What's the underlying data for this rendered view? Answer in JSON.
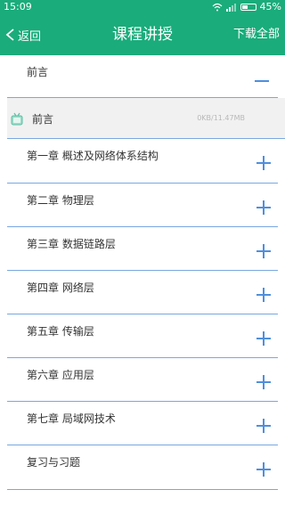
{
  "status": {
    "time": "15:09",
    "battery": "45%",
    "battery_level": 0.45
  },
  "header": {
    "back_label": "返回",
    "title": "课程讲授",
    "download_all_label": "下载全部"
  },
  "sections": [
    {
      "label": "前言",
      "expanded": true
    },
    {
      "label": "第一章 概述及网络体系结构",
      "expanded": false
    },
    {
      "label": "第二章 物理层",
      "expanded": false
    },
    {
      "label": "第三章 数据链路层",
      "expanded": false
    },
    {
      "label": "第四章 网络层",
      "expanded": false
    },
    {
      "label": "第五章 传输层",
      "expanded": false
    },
    {
      "label": "第六章 应用层",
      "expanded": false
    },
    {
      "label": "第七章 局域网技术",
      "expanded": false
    },
    {
      "label": "复习与习题",
      "expanded": false
    }
  ],
  "lesson_item": {
    "label": "前言",
    "size": "0KB/11.47MB"
  },
  "colors": {
    "accent": "#1aac7b",
    "divider": "#7aa7e0",
    "plus": "#4e8fde"
  }
}
